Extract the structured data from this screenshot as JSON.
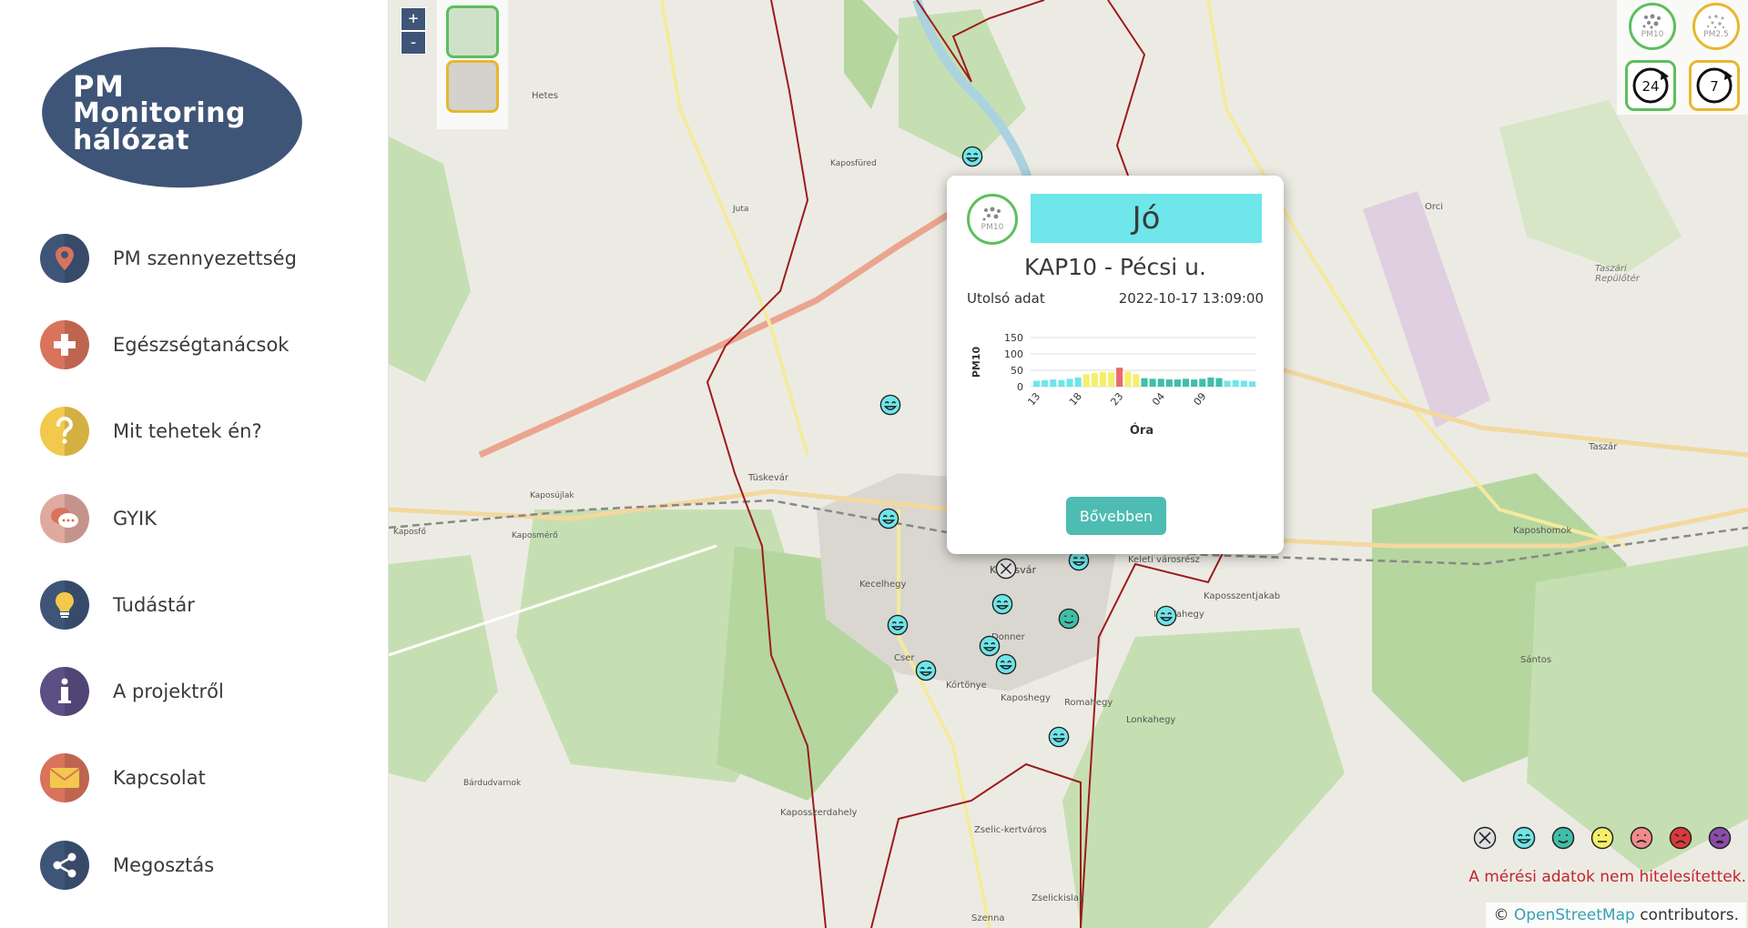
{
  "logo": {
    "line1": "PM",
    "line2": "Monitoring",
    "line3": "hálózat"
  },
  "nav": [
    {
      "label": "PM szennyezettség",
      "icon": "map-pin-icon",
      "color": "#3f5578"
    },
    {
      "label": "Egészségtanácsok",
      "icon": "health-cross-icon",
      "color": "#d9735b"
    },
    {
      "label": "Mit tehetek én?",
      "icon": "question-icon",
      "color": "#f2c94c"
    },
    {
      "label": "GYIK",
      "icon": "chat-icon",
      "color": "#e0a9a0"
    },
    {
      "label": "Tudástár",
      "icon": "lightbulb-icon",
      "color": "#3f5578"
    },
    {
      "label": "A projektről",
      "icon": "info-icon",
      "color": "#5c4f86"
    },
    {
      "label": "Kapcsolat",
      "icon": "envelope-icon",
      "color": "#d9735b"
    },
    {
      "label": "Megosztás",
      "icon": "share-icon",
      "color": "#3f5578"
    }
  ],
  "zoom": {
    "in": "+",
    "out": "-"
  },
  "controls": {
    "pm10": "PM10",
    "pm25": "PM2.5",
    "t24": "24",
    "t7": "7"
  },
  "popup": {
    "badge": "PM10",
    "status": "Jó",
    "status_color": "#6ee6ea",
    "station": "KAP10 - Pécsi u.",
    "last_label": "Utolsó adat",
    "last_value": "2022-10-17 13:09:00",
    "more_button": "Bővebben"
  },
  "chart_data": {
    "type": "bar",
    "ylabel": "PM10",
    "xlabel": "Óra",
    "yticks": [
      0,
      50,
      100,
      150
    ],
    "ylim": [
      0,
      150
    ],
    "xtick_labels": [
      "13",
      "18",
      "23",
      "04",
      "09"
    ],
    "values": [
      18,
      20,
      22,
      20,
      24,
      28,
      38,
      42,
      45,
      44,
      58,
      46,
      38,
      26,
      24,
      24,
      22,
      22,
      24,
      22,
      24,
      28,
      26,
      18,
      20,
      18,
      16
    ],
    "colors": [
      "#6ee6ea",
      "#6ee6ea",
      "#6ee6ea",
      "#6ee6ea",
      "#6ee6ea",
      "#6ee6ea",
      "#f5ef6a",
      "#f5ef6a",
      "#f5ef6a",
      "#f5ef6a",
      "#e86a6a",
      "#f5ef6a",
      "#f5ef6a",
      "#3fbfa8",
      "#3fbfa8",
      "#3fbfa8",
      "#3fbfa8",
      "#3fbfa8",
      "#3fbfa8",
      "#3fbfa8",
      "#3fbfa8",
      "#3fbfa8",
      "#3fbfa8",
      "#6ee6ea",
      "#6ee6ea",
      "#6ee6ea",
      "#6ee6ea"
    ]
  },
  "legend": [
    {
      "name": "no-data",
      "color": "#e0e0e0"
    },
    {
      "name": "very-good",
      "color": "#6ee6ea"
    },
    {
      "name": "good",
      "color": "#3fbfa8"
    },
    {
      "name": "moderate",
      "color": "#f5ef6a"
    },
    {
      "name": "bad",
      "color": "#f28a8a"
    },
    {
      "name": "very-bad",
      "color": "#d83a3a"
    },
    {
      "name": "extreme",
      "color": "#8a4ca8"
    }
  ],
  "disclaimer": "A mérési adatok nem hitelesítettek.",
  "attribution": {
    "prefix": "©",
    "link": "OpenStreetMap",
    "suffix": "contributors."
  },
  "map_labels": [
    "Kaposfüred",
    "Tüskevár",
    "Kaposmérő",
    "Kaposfő",
    "Kaposújlak",
    "Juta",
    "Hetes",
    "Kecelhegy",
    "Cser",
    "Kórtönye",
    "Donner",
    "Kaposhegy",
    "Romahegy",
    "Lonkahegy",
    "Ivánfahegy",
    "Kaposszentjakab",
    "Kaposszerdahely",
    "Zselic-kertváros",
    "Zselickislak",
    "Bárdudvarnok",
    "Orci",
    "Taszár",
    "Kaposhomok",
    "Sántos",
    "Szenna",
    "Taszári Repülőtér",
    "Keleti városrész",
    "Kaposvár"
  ]
}
